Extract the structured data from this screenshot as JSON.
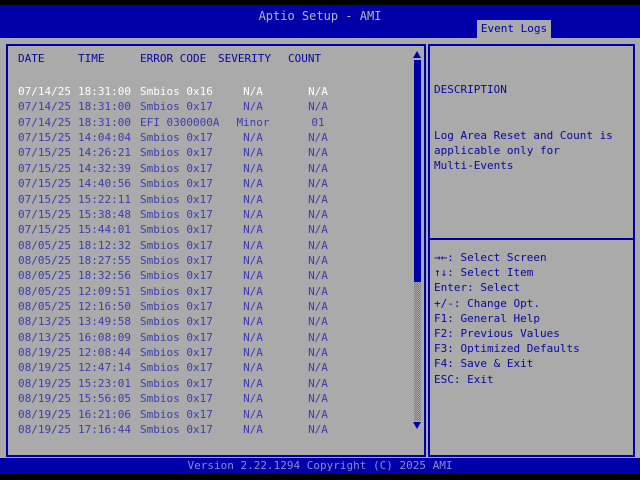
{
  "header": {
    "title": "Aptio Setup - AMI",
    "tab": "Event Logs"
  },
  "table": {
    "columns": [
      "DATE",
      "TIME",
      "ERROR CODE",
      "SEVERITY",
      "COUNT"
    ],
    "rows": [
      {
        "date": "07/14/25",
        "time": "18:31:00",
        "error": "Smbios 0x16",
        "severity": "N/A",
        "count": "N/A",
        "selected": true
      },
      {
        "date": "07/14/25",
        "time": "18:31:00",
        "error": "Smbios 0x17",
        "severity": "N/A",
        "count": "N/A",
        "selected": false
      },
      {
        "date": "07/14/25",
        "time": "18:31:00",
        "error": "EFI 0300000A",
        "severity": "Minor",
        "count": "01",
        "selected": false
      },
      {
        "date": "07/15/25",
        "time": "14:04:04",
        "error": "Smbios 0x17",
        "severity": "N/A",
        "count": "N/A",
        "selected": false
      },
      {
        "date": "07/15/25",
        "time": "14:26:21",
        "error": "Smbios 0x17",
        "severity": "N/A",
        "count": "N/A",
        "selected": false
      },
      {
        "date": "07/15/25",
        "time": "14:32:39",
        "error": "Smbios 0x17",
        "severity": "N/A",
        "count": "N/A",
        "selected": false
      },
      {
        "date": "07/15/25",
        "time": "14:40:56",
        "error": "Smbios 0x17",
        "severity": "N/A",
        "count": "N/A",
        "selected": false
      },
      {
        "date": "07/15/25",
        "time": "15:22:11",
        "error": "Smbios 0x17",
        "severity": "N/A",
        "count": "N/A",
        "selected": false
      },
      {
        "date": "07/15/25",
        "time": "15:38:48",
        "error": "Smbios 0x17",
        "severity": "N/A",
        "count": "N/A",
        "selected": false
      },
      {
        "date": "07/15/25",
        "time": "15:44:01",
        "error": "Smbios 0x17",
        "severity": "N/A",
        "count": "N/A",
        "selected": false
      },
      {
        "date": "08/05/25",
        "time": "18:12:32",
        "error": "Smbios 0x17",
        "severity": "N/A",
        "count": "N/A",
        "selected": false
      },
      {
        "date": "08/05/25",
        "time": "18:27:55",
        "error": "Smbios 0x17",
        "severity": "N/A",
        "count": "N/A",
        "selected": false
      },
      {
        "date": "08/05/25",
        "time": "18:32:56",
        "error": "Smbios 0x17",
        "severity": "N/A",
        "count": "N/A",
        "selected": false
      },
      {
        "date": "08/05/25",
        "time": "12:09:51",
        "error": "Smbios 0x17",
        "severity": "N/A",
        "count": "N/A",
        "selected": false
      },
      {
        "date": "08/05/25",
        "time": "12:16:50",
        "error": "Smbios 0x17",
        "severity": "N/A",
        "count": "N/A",
        "selected": false
      },
      {
        "date": "08/13/25",
        "time": "13:49:58",
        "error": "Smbios 0x17",
        "severity": "N/A",
        "count": "N/A",
        "selected": false
      },
      {
        "date": "08/13/25",
        "time": "16:08:09",
        "error": "Smbios 0x17",
        "severity": "N/A",
        "count": "N/A",
        "selected": false
      },
      {
        "date": "08/19/25",
        "time": "12:08:44",
        "error": "Smbios 0x17",
        "severity": "N/A",
        "count": "N/A",
        "selected": false
      },
      {
        "date": "08/19/25",
        "time": "12:47:14",
        "error": "Smbios 0x17",
        "severity": "N/A",
        "count": "N/A",
        "selected": false
      },
      {
        "date": "08/19/25",
        "time": "15:23:01",
        "error": "Smbios 0x17",
        "severity": "N/A",
        "count": "N/A",
        "selected": false
      },
      {
        "date": "08/19/25",
        "time": "15:56:05",
        "error": "Smbios 0x17",
        "severity": "N/A",
        "count": "N/A",
        "selected": false
      },
      {
        "date": "08/19/25",
        "time": "16:21:06",
        "error": "Smbios 0x17",
        "severity": "N/A",
        "count": "N/A",
        "selected": false
      },
      {
        "date": "08/19/25",
        "time": "17:16:44",
        "error": "Smbios 0x17",
        "severity": "N/A",
        "count": "N/A",
        "selected": false
      }
    ]
  },
  "help": {
    "description_title": "DESCRIPTION",
    "description_lines": [
      "Log Area Reset and Count is",
      "applicable only for",
      "Multi-Events"
    ],
    "keys": [
      {
        "keys": "→←",
        "label": "Select Screen"
      },
      {
        "keys": "↑↓",
        "label": "Select Item"
      },
      {
        "keys": "Enter",
        "label": "Select"
      },
      {
        "keys": "+/-",
        "label": "Change Opt."
      },
      {
        "keys": "F1",
        "label": "General Help"
      },
      {
        "keys": "F2",
        "label": "Previous Values"
      },
      {
        "keys": "F3",
        "label": "Optimized Defaults"
      },
      {
        "keys": "F4",
        "label": "Save & Exit"
      },
      {
        "keys": "ESC",
        "label": "Exit"
      }
    ]
  },
  "footer": {
    "version": "Version 2.22.1294 Copyright (C) 2025 AMI"
  },
  "colors": {
    "navy": "#0000a8",
    "gray": "#aaaaaa",
    "row_text": "#3c3cb0",
    "selected_row_text": "#ffffff",
    "title_text": "#b8b8b8",
    "footer_text": "#8c8cd0",
    "black": "#000000"
  }
}
